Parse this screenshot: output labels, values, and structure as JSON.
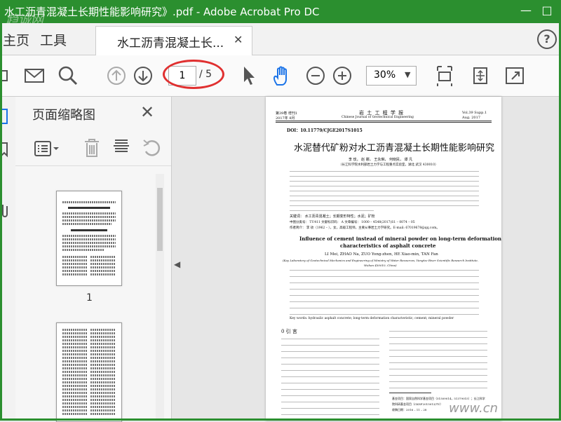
{
  "window": {
    "title": "水工沥青混凝土长期性能影响研究》.pdf - Adobe Acrobat Pro DC",
    "watermark": "趋诚网"
  },
  "menu": {
    "home": "主页",
    "tools": "工具",
    "tab_label": "水工沥青混凝土长...",
    "help": "?"
  },
  "toolbar": {
    "page_current": "1",
    "page_total": "/ 5",
    "zoom": "30%"
  },
  "thumbnail_panel": {
    "title": "页面缩略图",
    "page_number": "1"
  },
  "paper": {
    "header_left_1": "第39卷 增刊1",
    "header_left_2": "2017年 8月",
    "journal_cn": "岩 土 工 程 学 报",
    "journal_en": "Chinese Journal of Geotechnical Engineering",
    "header_right_1": "Vol.39 Supp.1",
    "header_right_2": "Aug. 2017",
    "doi": "DOI：10.11779/CJGE2017S1015",
    "title_cn": "水泥替代矿粉对水工沥青混凝土长期性能影响研究",
    "authors_cn": "李 玫， 赵 娜， 王永琳， 何晓民， 谭 凡",
    "affiliation_cn": "（长江科学院水利部岩土力学与工程重点实验室，湖北 武汉 430010）",
    "keywords_cn": "关键词： 水工沥青混凝土；长期变形特性；水泥；矿粉",
    "class_cn": "中图分类号： TU411    文献标识码： A    文章编号： 1000 – 4548(2017)S1 – 0074 – 05",
    "author_note_cn": "作者简介： 李 玫（1962 – ），女，高级工程师，主要从事岩土力学研究。E-mail: 67019678@qq.com。",
    "title_en_1": "Influence of cement instead of mineral powder on long-term deformation",
    "title_en_2": "characteristics of asphalt concrete",
    "authors_en": "LI Mei, ZHAO Na, ZUO Yong-zhen, HE Xiao-min, TAN Fan",
    "affiliation_en_1": "(Key Laboratory of Geotechnical Mechanics and Engineering of Ministry of Water Resources, Yangtze River Scientific Research Institute,",
    "affiliation_en_2": "Wuhan 430010, China)",
    "keywords_en": "Key words: hydraulic asphalt concrete; long-term deformation characteristic; cement; mineral powder",
    "section_title": "0  引   言",
    "footnote_1": "基金项目：国家自然科学基金项目（51509014，51379015）；长江科学",
    "footnote_2": "院科研基金项目（CKSF2015013/TV）",
    "footnote_3": "收稿日期：2016 – 11 – 28"
  },
  "site_watermark": "www.cn"
}
